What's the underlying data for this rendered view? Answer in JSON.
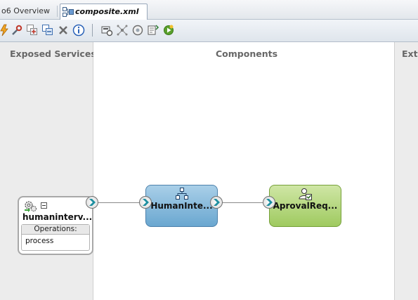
{
  "tabs": [
    {
      "label": "o6 Overview",
      "active": false
    },
    {
      "label": "composite.xml",
      "active": true
    }
  ],
  "toolbar": {
    "buttons": [
      "lightning-icon",
      "wrench-icon",
      "add-component-icon",
      "replace-icon",
      "delete-icon",
      "info-icon",
      "test-icon",
      "sensor-icon",
      "compile-icon",
      "deploy-icon",
      "run-icon"
    ]
  },
  "lanes": {
    "left": "Exposed Services",
    "middle": "Components",
    "right": "Exte"
  },
  "service": {
    "name": "humaninterv...",
    "operations_header": "Operations:",
    "operations": [
      "process"
    ]
  },
  "components": {
    "human_task": "HumanInte...",
    "business_rule": "AprovalReq..."
  },
  "colors": {
    "human_task": "#7fb3d8",
    "business_rule": "#b2d57c",
    "lane_bg": "#ececec",
    "port_chevron": "#1f8fa0"
  }
}
